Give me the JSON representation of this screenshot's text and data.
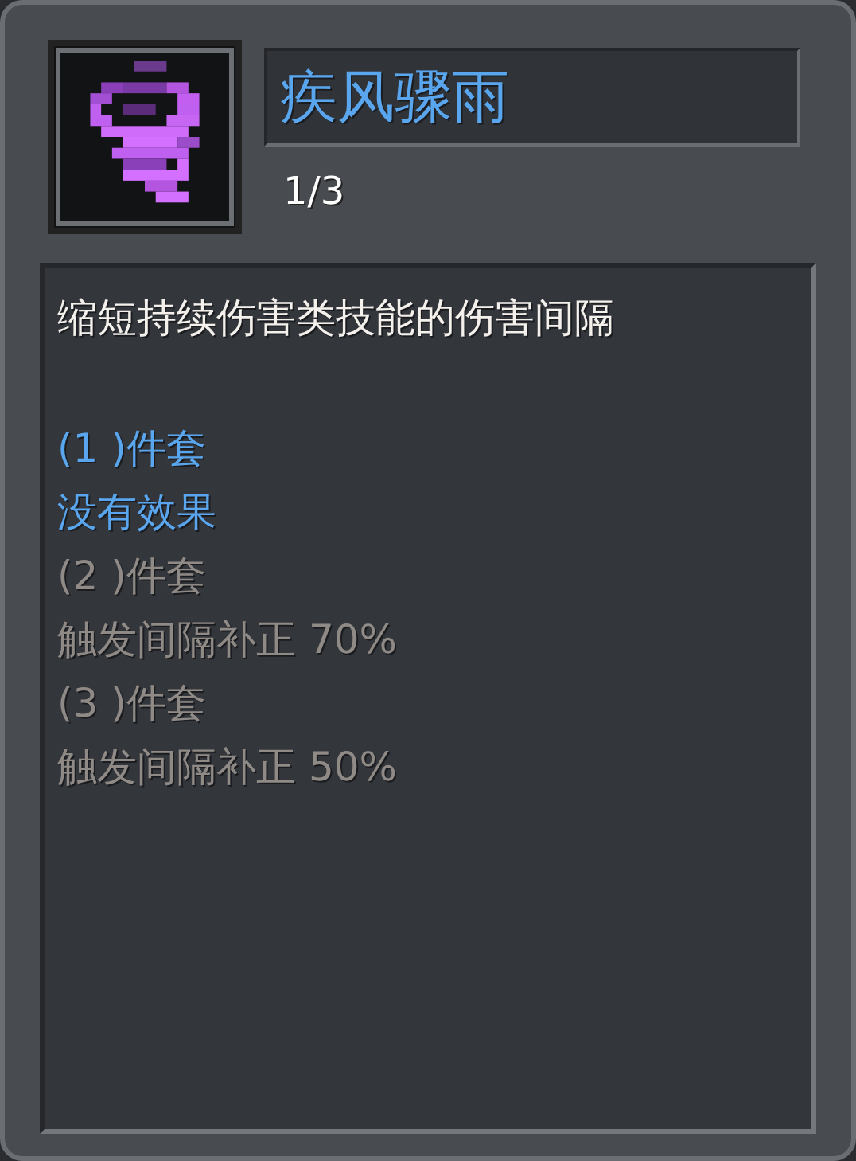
{
  "item": {
    "name": "疾风骤雨",
    "count": "1/3"
  },
  "description": "缩短持续伤害类技能的伤害间隔",
  "set_tiers": [
    {
      "label": "(1 )件套",
      "effect": "没有效果",
      "active": true
    },
    {
      "label": "(2 )件套",
      "effect": "触发间隔补正 70%",
      "active": false
    },
    {
      "label": "(3 )件套",
      "effect": "触发间隔补正 50%",
      "active": false
    }
  ]
}
